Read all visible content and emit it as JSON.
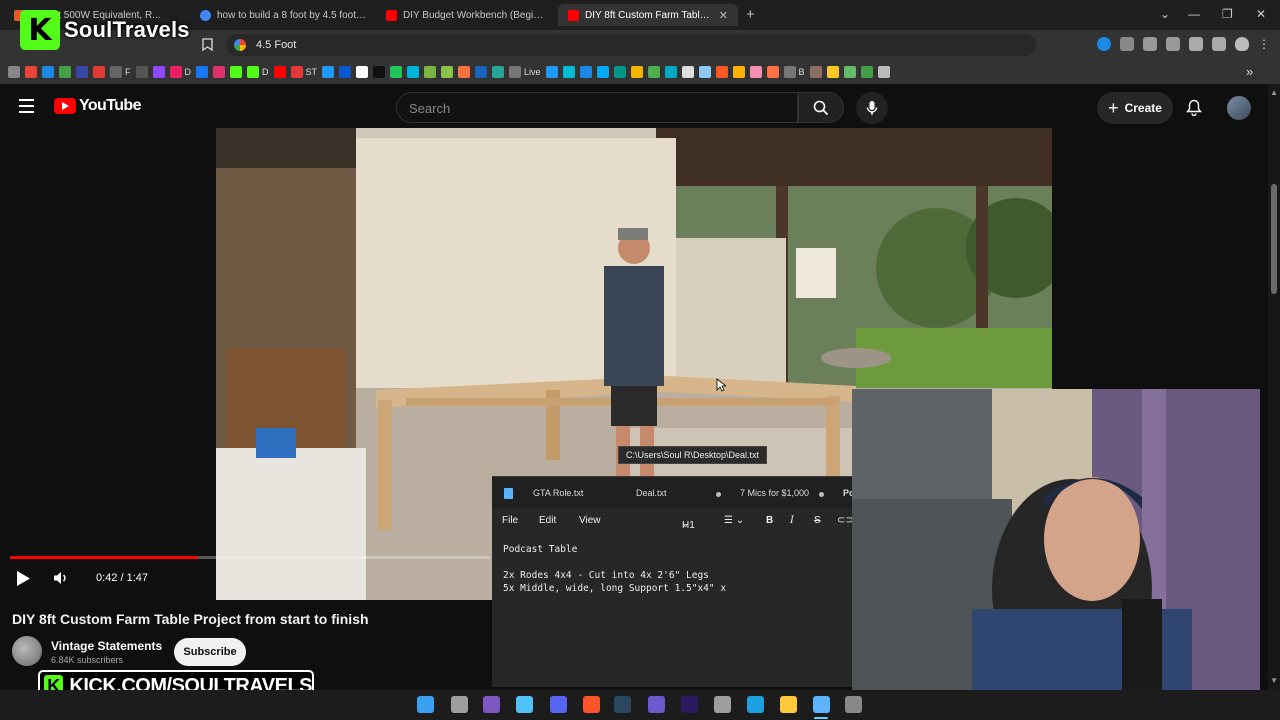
{
  "browser": {
    "tabs": [
      {
        "title": "d Light 500W Equivalent, R...",
        "favicon": "#e8562a",
        "active": false
      },
      {
        "title": "how to build a 8 foot by 4.5 foot tabl...",
        "favicon": "#4285f4",
        "active": false
      },
      {
        "title": "DIY Budget Workbench (Beginner Bu...",
        "favicon": "#ff0000",
        "active": false
      },
      {
        "title": "DIY 8ft Custom Farm Table Proje...",
        "favicon": "#ff0000",
        "active": true
      }
    ],
    "new_tab": "+",
    "address": "4.5 Foot",
    "bookmarks": [
      {
        "label": "",
        "color": "#888"
      },
      {
        "label": "",
        "color": "#ea4335"
      },
      {
        "label": "",
        "color": "#1e88e5"
      },
      {
        "label": "",
        "color": "#43a047"
      },
      {
        "label": "",
        "color": "#3949ab"
      },
      {
        "label": "",
        "color": "#e53935"
      },
      {
        "label": "F",
        "color": "#666"
      },
      {
        "label": "",
        "color": "#555"
      },
      {
        "label": "",
        "color": "#9146ff"
      },
      {
        "label": "D",
        "color": "#e91e63"
      },
      {
        "label": "",
        "color": "#1877f2"
      },
      {
        "label": "",
        "color": "#e1306c"
      },
      {
        "label": "",
        "color": "#53fc18"
      },
      {
        "label": "D",
        "color": "#53fc18"
      },
      {
        "label": "",
        "color": "#ff0000"
      },
      {
        "label": "ST",
        "color": "#e53935"
      },
      {
        "label": "",
        "color": "#2196f3"
      },
      {
        "label": "",
        "color": "#0b57d0"
      },
      {
        "label": "",
        "color": "#fff"
      },
      {
        "label": "",
        "color": "#111"
      },
      {
        "label": "",
        "color": "#21c45d"
      },
      {
        "label": "",
        "color": "#00b4d8"
      },
      {
        "label": "",
        "color": "#7cb342"
      },
      {
        "label": "",
        "color": "#8bc34a"
      },
      {
        "label": "",
        "color": "#ff7043"
      },
      {
        "label": "",
        "color": "#1565c0"
      },
      {
        "label": "",
        "color": "#26a69a"
      },
      {
        "label": "Live",
        "color": "#777"
      },
      {
        "label": "",
        "color": "#2196f3"
      },
      {
        "label": "",
        "color": "#00bcd4"
      },
      {
        "label": "",
        "color": "#1e88e5"
      },
      {
        "label": "",
        "color": "#03a9f4"
      },
      {
        "label": "",
        "color": "#009688"
      },
      {
        "label": "",
        "color": "#f4b400"
      },
      {
        "label": "",
        "color": "#4caf50"
      },
      {
        "label": "",
        "color": "#00acc1"
      },
      {
        "label": "",
        "color": "#ddd"
      },
      {
        "label": "",
        "color": "#90caf9"
      },
      {
        "label": "",
        "color": "#ff5722"
      },
      {
        "label": "",
        "color": "#ffb300"
      },
      {
        "label": "",
        "color": "#f48fb1"
      },
      {
        "label": "",
        "color": "#ff7043"
      },
      {
        "label": "B",
        "color": "#777"
      },
      {
        "label": "",
        "color": "#8d6e63"
      },
      {
        "label": "",
        "color": "#ffca28"
      },
      {
        "label": "",
        "color": "#66bb6a"
      },
      {
        "label": "",
        "color": "#43a047"
      },
      {
        "label": "",
        "color": "#bbb"
      }
    ],
    "more_bookmarks": "»"
  },
  "kick": {
    "logo_letter": "K",
    "streamer": "SoulTravels",
    "banner": "KICK.COM/SOULTRAVELS",
    "color": "#53fc18"
  },
  "youtube": {
    "wordmark": "YouTube",
    "search_placeholder": "Search",
    "create_label": "Create",
    "video": {
      "title": "DIY 8ft Custom Farm Table Project from start to finish",
      "current_time": "0:42",
      "duration": "1:47",
      "time_separator": " / ",
      "progress": 0.3925
    },
    "channel": {
      "name": "Vintage Statements",
      "subscribers": "6.84K subscribers",
      "subscribe_label": "Subscribe"
    }
  },
  "notepad": {
    "tooltip": "C:\\Users\\Soul R\\Desktop\\Deal.txt",
    "tabs": [
      "GTA Role.txt",
      "Deal.txt",
      "7 Mics for $1,000",
      "Po"
    ],
    "menu": {
      "file": "File",
      "edit": "Edit",
      "view": "View",
      "heading": "H1"
    },
    "content": {
      "line1": "Podcast Table",
      "line2": "",
      "line3": "2x Rodes 4x4 - Cut into 4x 2'6\" Legs",
      "line4": "5x Middle, wide, long Support 1.5\"x4\" x"
    }
  },
  "taskbar": {
    "icons": [
      {
        "name": "windows-start-icon",
        "color": "#3aa0f3"
      },
      {
        "name": "task-view-icon",
        "color": "#9e9e9e"
      },
      {
        "name": "snipping-tool-icon",
        "color": "#7e57c2"
      },
      {
        "name": "photos-icon",
        "color": "#4fc3f7"
      },
      {
        "name": "discord-icon",
        "color": "#5865f2"
      },
      {
        "name": "brave-icon",
        "color": "#fb542b"
      },
      {
        "name": "steam-icon",
        "color": "#2a475e"
      },
      {
        "name": "audio-app-icon",
        "color": "#6a5acd"
      },
      {
        "name": "premiere-icon",
        "color": "#2a1a5e"
      },
      {
        "name": "chrome-icon",
        "color": "#9e9e9e"
      },
      {
        "name": "edge-icon",
        "color": "#1ba1e2"
      },
      {
        "name": "file-explorer-icon",
        "color": "#ffc83d"
      },
      {
        "name": "notepad-icon",
        "color": "#5cb3ff"
      },
      {
        "name": "overflow-icon",
        "color": "#888"
      }
    ]
  }
}
